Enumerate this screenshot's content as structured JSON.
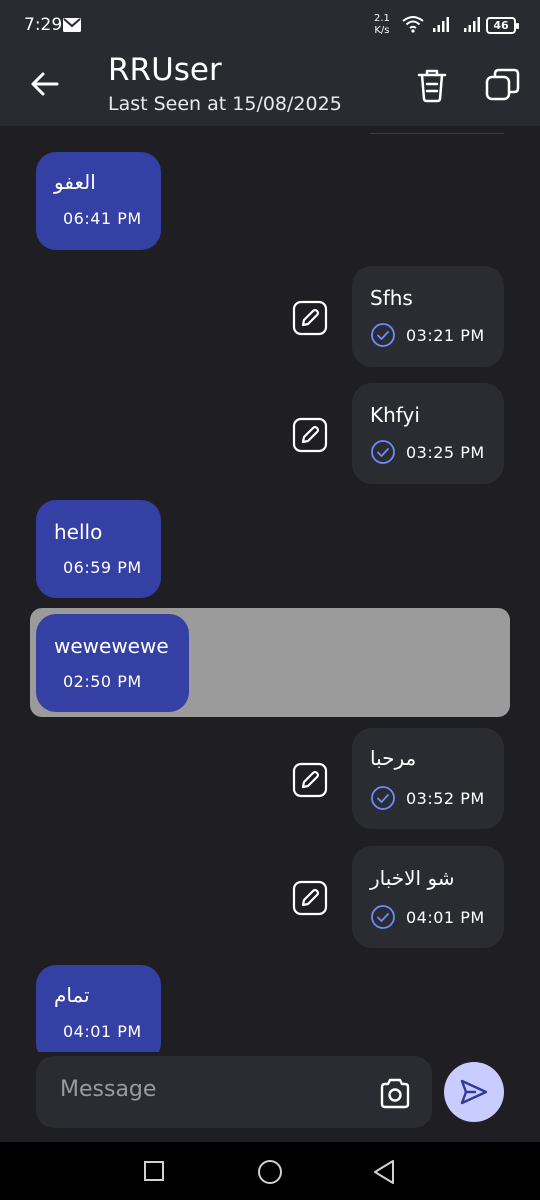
{
  "status_bar": {
    "time": "7:29",
    "net_speed_value": "2.1",
    "net_speed_unit": "K/s",
    "battery": "46"
  },
  "header": {
    "title": "RRUser",
    "subtitle": "Last Seen at 15/08/2025"
  },
  "messages": [
    {
      "direction": "incoming",
      "text": "العفو",
      "time": "06:41 PM"
    },
    {
      "direction": "outgoing",
      "text": "Sfhs",
      "time": "03:21 PM"
    },
    {
      "direction": "outgoing",
      "text": "Khfyi",
      "time": "03:25 PM"
    },
    {
      "direction": "incoming",
      "text": "hello",
      "time": "06:59 PM"
    },
    {
      "direction": "incoming",
      "text": "wewewewe",
      "time": "02:50 PM",
      "selected": true
    },
    {
      "direction": "outgoing",
      "text": "مرحبا",
      "time": "03:52 PM"
    },
    {
      "direction": "outgoing",
      "text": "شو الاخبار",
      "time": "04:01 PM"
    },
    {
      "direction": "incoming",
      "text": "تمام",
      "time": "04:01 PM"
    }
  ],
  "input": {
    "placeholder": "Message"
  },
  "colors": {
    "incoming_bubble": "#3440a3",
    "outgoing_bubble": "#2b2c31",
    "background": "#1f1f23",
    "send_button": "#c9ccff",
    "check_icon": "#6b8cff"
  },
  "icons": {
    "back": "arrow-left-icon",
    "delete": "trash-icon",
    "copy": "copy-icon",
    "edit": "pencil-icon",
    "read_status": "check-circle-icon",
    "camera": "camera-icon",
    "send": "send-icon"
  }
}
